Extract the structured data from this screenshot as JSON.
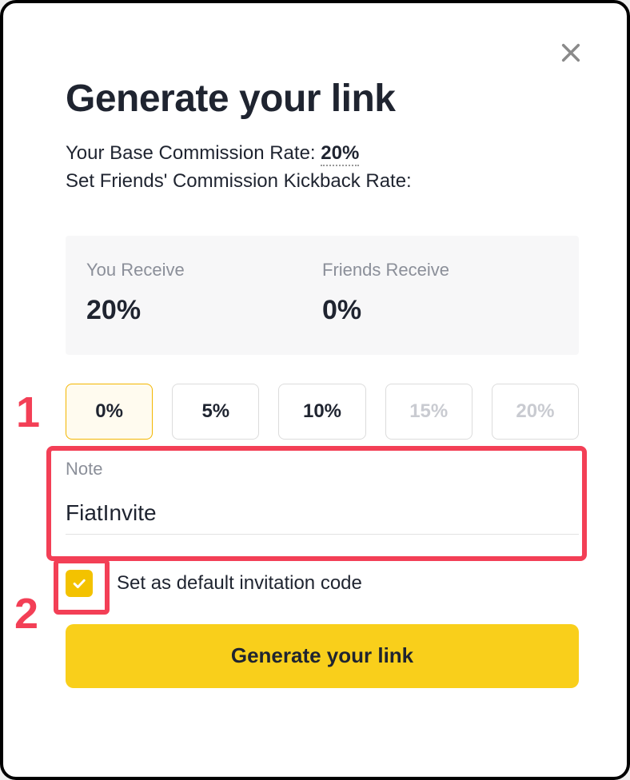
{
  "modal": {
    "title": "Generate your link",
    "base_label": "Your Base Commission Rate:",
    "base_value": "20%",
    "kickback_label": "Set Friends' Commission Kickback Rate:"
  },
  "rates": {
    "you_label": "You Receive",
    "you_value": "20%",
    "friends_label": "Friends Receive",
    "friends_value": "0%"
  },
  "options": [
    "0%",
    "5%",
    "10%",
    "15%",
    "20%"
  ],
  "selected_option_index": 0,
  "disabled_option_indices": [
    3,
    4
  ],
  "note": {
    "label": "Note",
    "value": "FiatInvite"
  },
  "default_checkbox": {
    "checked": true,
    "label": "Set as default invitation code"
  },
  "submit_label": "Generate your link",
  "annotations": {
    "num1": "1",
    "num2": "2"
  }
}
